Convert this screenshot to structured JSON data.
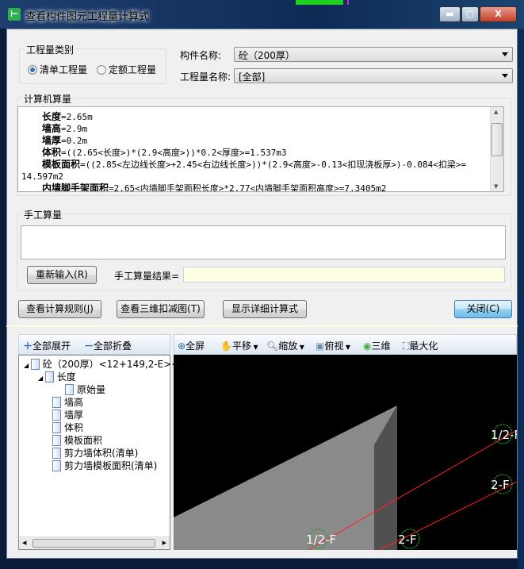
{
  "window": {
    "title": "查看构件图元工程量计算式",
    "minimize": "▬",
    "maximize": "▢",
    "close": "X"
  },
  "qty_type": {
    "label": "工程量类别",
    "options": [
      {
        "label": "清单工程量",
        "selected": true
      },
      {
        "label": "定额工程量",
        "selected": false
      }
    ]
  },
  "component_name": {
    "label": "构件名称:",
    "value": "砼（200厚）"
  },
  "quantity_name": {
    "label": "工程量名称:",
    "value": "[全部]"
  },
  "computer_calc": {
    "label": "计算机算量",
    "lines": [
      {
        "name": "长度",
        "expr": "=2.65m"
      },
      {
        "name": "墙高",
        "expr": "=2.9m"
      },
      {
        "name": "墙厚",
        "expr": "=0.2m"
      },
      {
        "name": "体积",
        "expr": "=((2.65<长度>)*(2.9<高度>))*0.2<厚度>=1.537m3"
      },
      {
        "name": "模板面积",
        "expr": "=((2.85<左边线长度>+2.45<右边线长度>))*(2.9<高度>-0.13<扣现浇板厚>)-0.084<扣梁>="
      },
      {
        "name": "",
        "expr": "14.597m2"
      },
      {
        "name": "内墙脚手架面积",
        "expr": "=2.65<内墙脚手架面积长度>*2.77<内墙脚手架面积高度>=7.3405m2"
      }
    ]
  },
  "manual_calc": {
    "label": "手工算量",
    "value": "",
    "reenter_button": "重新输入(R)",
    "result_label": "手工算量结果=",
    "result_value": ""
  },
  "actions": {
    "view_rules": "查看计算规则(J)",
    "view_3d": "查看三维扣减图(T)",
    "show_detail": "显示详细计算式",
    "close": "关闭(C)"
  },
  "tree_toolbar": {
    "expand_all": "全部展开",
    "collapse_all": "全部折叠"
  },
  "tree": {
    "root": "砼（200厚）<12+149,2-E><",
    "children": [
      {
        "label": "长度",
        "children": [
          "原始量"
        ]
      },
      {
        "label": "墙高"
      },
      {
        "label": "墙厚"
      },
      {
        "label": "体积"
      },
      {
        "label": "模板面积"
      },
      {
        "label": "剪力墙体积(清单)"
      },
      {
        "label": "剪力墙模板面积(清单)"
      }
    ]
  },
  "view_toolbar": {
    "fullscreen": "全屏",
    "pan": "平移",
    "zoom": "缩放",
    "top_view": "俯视",
    "three_d": "三维",
    "maximize": "最大化"
  },
  "viewport": {
    "axis_labels": [
      "1/2-F",
      "2-F",
      "1/2-F",
      "2-F"
    ]
  },
  "colors": {
    "accent": "#3c7fb1",
    "viewport_bg": "#000000",
    "axis_line": "#ff2020",
    "axis_marker": "#1faa1f",
    "manual_result_bg": "#ffffe1"
  }
}
